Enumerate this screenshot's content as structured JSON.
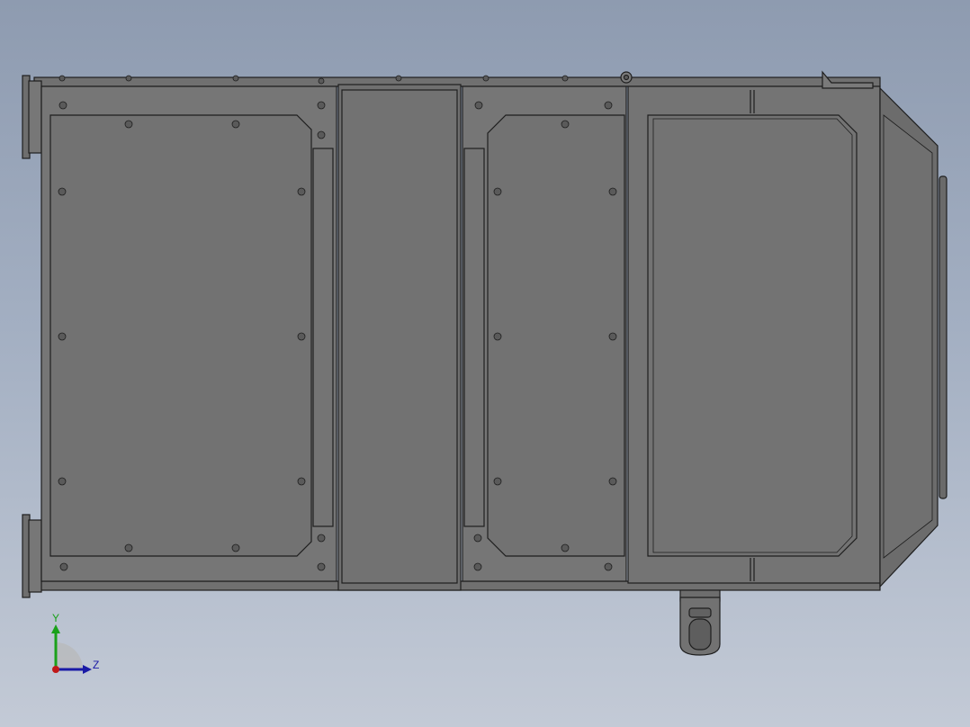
{
  "view": {
    "background_top": "#8e9bb0",
    "background_bottom": "#c3cad6",
    "part_fill": "#757575",
    "part_fill_dark": "#6b6b6b",
    "edge_color": "#1e1e1e",
    "bolt_icon": "hex-bolt-icon"
  },
  "triad": {
    "y_label": "Y",
    "z_label": "Z",
    "y_color": "#1aa11a",
    "z_color": "#1a1aa6",
    "x_color": "#c01818"
  }
}
